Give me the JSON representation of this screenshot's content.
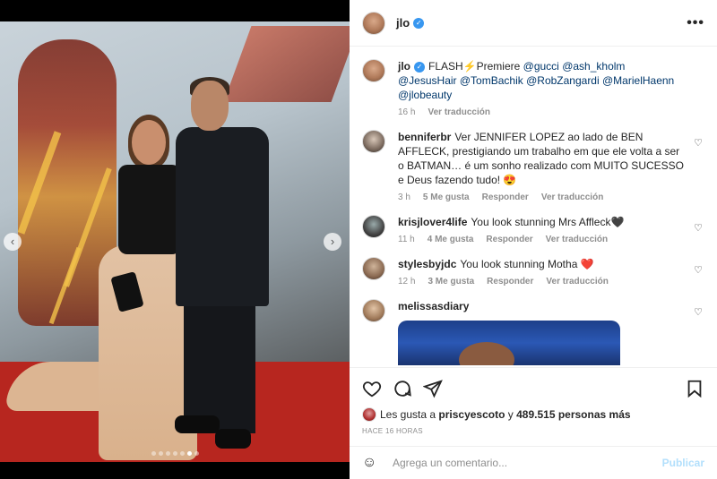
{
  "post": {
    "username": "jlo",
    "caption": {
      "prefix": "FLASH⚡Premiere",
      "mentions": [
        "@gucci",
        "@ash_kholm",
        "@JesusHair",
        "@TomBachik",
        "@RobZangardi",
        "@MarielHaenn",
        "@jlobeauty"
      ],
      "time": "16 h",
      "translate": "Ver traducción"
    },
    "carousel": {
      "count": 7,
      "active_index": 5,
      "prev": "‹",
      "next": "›"
    }
  },
  "comments": [
    {
      "username": "benniferbr",
      "text": "Ver JENNIFER LOPEZ ao lado de BEN AFFLECK, prestigiando um trabalho em que ele volta a ser o BATMAN… é um sonho realizado com MUITO SUCESSO e Deus fazendo tudo! 😍",
      "time": "3 h",
      "likes": "5 Me gusta",
      "reply": "Responder",
      "translate": "Ver traducción"
    },
    {
      "username": "krisjlover4life",
      "text": "You look stunning Mrs Affleck🖤",
      "time": "11 h",
      "likes": "4 Me gusta",
      "reply": "Responder",
      "translate": "Ver traducción"
    },
    {
      "username": "stylesbyjdc",
      "text": "You look stunning Motha ❤️",
      "time": "12 h",
      "likes": "3 Me gusta",
      "reply": "Responder",
      "translate": "Ver traducción"
    },
    {
      "username": "melissasdiary",
      "text": ""
    }
  ],
  "likes_line": {
    "prefix": "Les gusta a",
    "user": "priscyescoto",
    "middle": "y",
    "count": "489.515 personas más"
  },
  "ago": "HACE 16 HORAS",
  "add_comment": {
    "placeholder": "Agrega un comentario...",
    "post_label": "Publicar"
  },
  "icons": {
    "more": "•••",
    "verified": "✓",
    "heart": "♡",
    "emoji": "☺"
  },
  "colors": {
    "link": "#00376b",
    "verified": "#3897f0",
    "muted": "#8e8e8e",
    "post_disabled": "#b2dffc"
  }
}
